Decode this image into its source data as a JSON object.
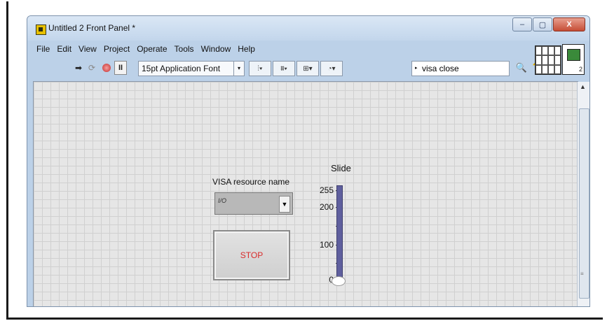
{
  "window": {
    "title": "Untitled 2 Front Panel *",
    "controls": {
      "minimize": "–",
      "maximize": "▢",
      "close": "X"
    }
  },
  "menu": {
    "items": [
      "File",
      "Edit",
      "View",
      "Project",
      "Operate",
      "Tools",
      "Window",
      "Help"
    ]
  },
  "toolbar": {
    "run_icon": "run-arrow-icon",
    "run_continuously_icon": "run-continuously-icon",
    "abort_icon": "abort-icon",
    "pause_label": "II",
    "font_select": "15pt Application Font",
    "font_select_arrow": "▾",
    "align_icon": "align-objects-icon",
    "distribute_icon": "distribute-objects-icon",
    "resize_icon": "resize-objects-icon",
    "reorder_icon": "reorder-icon",
    "search_value": "visa close",
    "search_icon": "magnifier-icon",
    "help_label": "?",
    "vi_icon_number": "2"
  },
  "panel": {
    "visa_label": "VISA resource name",
    "visa_value": "",
    "stop_label": "STOP",
    "slide_label": "Slide",
    "slide_ticks": [
      "255",
      "200",
      "100",
      "0"
    ],
    "slide_value": 0,
    "colors": {
      "stop_text": "#d92b2b",
      "slider_fill": "#5f5f9e",
      "grid_bg": "#e6e6e6"
    }
  }
}
